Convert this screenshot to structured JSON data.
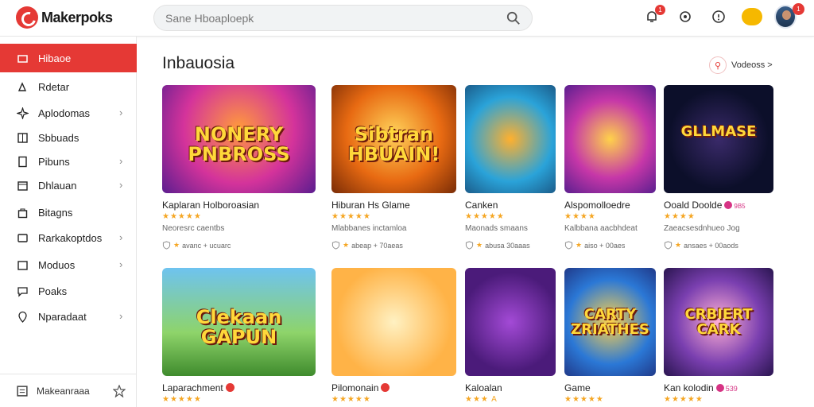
{
  "app": {
    "name": "Makerpoks"
  },
  "search": {
    "placeholder": "Sane Hboaploepk"
  },
  "header": {
    "notif_badge": "1",
    "avatar_badge": "1"
  },
  "sidebar": {
    "items": [
      {
        "label": "Hibaoe",
        "icon": "home-icon",
        "chevron": false,
        "active": true
      },
      {
        "label": "Rdetar",
        "icon": "gamepad-icon",
        "chevron": false,
        "active": false
      },
      {
        "label": "Aplodomas",
        "icon": "sparkle-icon",
        "chevron": true,
        "active": false
      },
      {
        "label": "Sbbuads",
        "icon": "grid-icon",
        "chevron": false,
        "active": false
      },
      {
        "label": "Pibuns",
        "icon": "document-icon",
        "chevron": true,
        "active": false
      },
      {
        "label": "Dhlauan",
        "icon": "calendar-icon",
        "chevron": true,
        "active": false
      },
      {
        "label": "Bitagns",
        "icon": "bag-icon",
        "chevron": false,
        "active": false
      },
      {
        "label": "Rarkakoptdos",
        "icon": "cart-icon",
        "chevron": true,
        "active": false
      },
      {
        "label": "Moduos",
        "icon": "box-icon",
        "chevron": true,
        "active": false
      },
      {
        "label": "Poaks",
        "icon": "chat-icon",
        "chevron": false,
        "active": false
      },
      {
        "label": "Nparadaat",
        "icon": "location-icon",
        "chevron": true,
        "active": false
      }
    ],
    "footer_label": "Makeanraaa"
  },
  "main": {
    "section_title": "Inbauosia",
    "more_label": "Vodeoss >",
    "cards": [
      {
        "thumb_text": "NONERY PNBROSS",
        "title": "Kaplaran Holboroasian",
        "stars": "★★★★★",
        "sub": "Neoresrc caentbs",
        "meta": "avanc + ucuarc"
      },
      {
        "thumb_text": "Sibtran HBUAIN!",
        "title": "Hiburan Hs Glame",
        "stars": "★★★★★",
        "sub": "Mlabbanes inctamloa",
        "meta": "abeap + 70aeas"
      },
      {
        "thumb_text": "",
        "title": "Canken",
        "stars": "★★★★★",
        "sub": "Maonads smaans",
        "meta": "abusa 30aaas"
      },
      {
        "thumb_text": "",
        "title": "Alspomolloedre",
        "stars": "★★★★",
        "sub": "Kalbbana aacbhdeat",
        "meta": "aiso + 00aes"
      },
      {
        "thumb_text": "GLLMASE",
        "title": "Ooald Doolde",
        "stars": "★★★★",
        "sub": "Zaeacsesdnhueo Jog",
        "meta": "ansaes + 00aods"
      },
      {
        "thumb_text": "Clekaan GAPUN",
        "title": "Laparachment",
        "stars": "★★★★★",
        "sub": "",
        "meta": ""
      },
      {
        "thumb_text": "",
        "title": "Pilomonain",
        "stars": "★★★★★",
        "sub": "",
        "meta": ""
      },
      {
        "thumb_text": "",
        "title": "Kaloalan",
        "stars": "★★★ A",
        "sub": "",
        "meta": ""
      },
      {
        "thumb_text": "CARTY ZRIATHES",
        "title": "Game",
        "stars": "★★★★★",
        "sub": "",
        "meta": ""
      },
      {
        "thumb_text": "CRBIERT CARK",
        "title": "Kan kolodin",
        "stars": "★★★★★",
        "sub": "",
        "meta": ""
      }
    ],
    "card_badges": {
      "c1": "",
      "c5": "9B5",
      "c10": "539"
    }
  },
  "colors": {
    "accent": "#e53935",
    "star": "#f5a623"
  }
}
